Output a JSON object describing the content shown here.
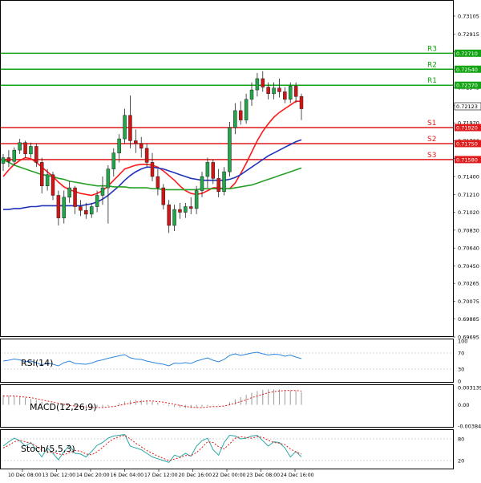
{
  "chart_data": {
    "type": "candlestick",
    "symbol_price": "0.72123",
    "price_axis": {
      "ylim": [
        0.69695,
        0.732
      ],
      "ticks": [
        "0.73105",
        "0.72915",
        "0.72725",
        "0.72535",
        "0.72345",
        "0.72155",
        "0.71970",
        "0.71780",
        "0.71590",
        "0.71400",
        "0.71210",
        "0.71020",
        "0.70830",
        "0.70640",
        "0.70450",
        "0.70265",
        "0.70075",
        "0.69885",
        "0.69695"
      ]
    },
    "time_axis": {
      "labels": [
        "10 Dec 08:00",
        "13 Dec 12:00",
        "14 Dec 20:00",
        "16 Dec 04:00",
        "17 Dec 12:00",
        "20 Dec 16:00",
        "22 Dec 00:00",
        "23 Dec 08:00",
        "24 Dec 16:00"
      ]
    },
    "levels": [
      {
        "label": "R3",
        "value": 0.7271,
        "value_text": "0.72710",
        "color": "#12a412"
      },
      {
        "label": "R2",
        "value": 0.7254,
        "value_text": "0.72540",
        "color": "#12a412"
      },
      {
        "label": "R1",
        "value": 0.7237,
        "value_text": "0.72370",
        "color": "#12a412"
      },
      {
        "label": "S1",
        "value": 0.7192,
        "value_text": "0.71920",
        "color": "#e01b1b"
      },
      {
        "label": "S2",
        "value": 0.7175,
        "value_text": "0.71750",
        "color": "#e01b1b"
      },
      {
        "label": "S3",
        "value": 0.7158,
        "value_text": "0.71580",
        "color": "#e01b1b"
      }
    ],
    "candles": [
      {
        "o": 0.7154,
        "h": 0.7164,
        "l": 0.7146,
        "c": 0.716
      },
      {
        "o": 0.716,
        "h": 0.7168,
        "l": 0.715,
        "c": 0.7156
      },
      {
        "o": 0.7156,
        "h": 0.7171,
        "l": 0.7152,
        "c": 0.7168
      },
      {
        "o": 0.7168,
        "h": 0.718,
        "l": 0.7164,
        "c": 0.7176
      },
      {
        "o": 0.7176,
        "h": 0.7178,
        "l": 0.716,
        "c": 0.7164
      },
      {
        "o": 0.7164,
        "h": 0.7176,
        "l": 0.716,
        "c": 0.7172
      },
      {
        "o": 0.7172,
        "h": 0.7175,
        "l": 0.715,
        "c": 0.7155
      },
      {
        "o": 0.7155,
        "h": 0.716,
        "l": 0.7122,
        "c": 0.713
      },
      {
        "o": 0.713,
        "h": 0.7148,
        "l": 0.7125,
        "c": 0.7142
      },
      {
        "o": 0.7142,
        "h": 0.7145,
        "l": 0.7115,
        "c": 0.712
      },
      {
        "o": 0.712,
        "h": 0.7125,
        "l": 0.7088,
        "c": 0.7096
      },
      {
        "o": 0.7096,
        "h": 0.7125,
        "l": 0.709,
        "c": 0.7118
      },
      {
        "o": 0.7118,
        "h": 0.7135,
        "l": 0.7112,
        "c": 0.7128
      },
      {
        "o": 0.7128,
        "h": 0.713,
        "l": 0.71,
        "c": 0.7108
      },
      {
        "o": 0.7108,
        "h": 0.7115,
        "l": 0.7098,
        "c": 0.7104
      },
      {
        "o": 0.7104,
        "h": 0.7112,
        "l": 0.7095,
        "c": 0.71
      },
      {
        "o": 0.71,
        "h": 0.7112,
        "l": 0.7096,
        "c": 0.7108
      },
      {
        "o": 0.7108,
        "h": 0.7125,
        "l": 0.7102,
        "c": 0.712
      },
      {
        "o": 0.712,
        "h": 0.714,
        "l": 0.711,
        "c": 0.7128
      },
      {
        "o": 0.7128,
        "h": 0.7152,
        "l": 0.709,
        "c": 0.7148
      },
      {
        "o": 0.7148,
        "h": 0.717,
        "l": 0.714,
        "c": 0.7165
      },
      {
        "o": 0.7165,
        "h": 0.7185,
        "l": 0.7155,
        "c": 0.718
      },
      {
        "o": 0.718,
        "h": 0.7212,
        "l": 0.7175,
        "c": 0.7205
      },
      {
        "o": 0.7205,
        "h": 0.7226,
        "l": 0.717,
        "c": 0.7178
      },
      {
        "o": 0.7178,
        "h": 0.719,
        "l": 0.7165,
        "c": 0.7175
      },
      {
        "o": 0.7175,
        "h": 0.7182,
        "l": 0.716,
        "c": 0.717
      },
      {
        "o": 0.717,
        "h": 0.7175,
        "l": 0.715,
        "c": 0.7155
      },
      {
        "o": 0.7155,
        "h": 0.7165,
        "l": 0.7135,
        "c": 0.714
      },
      {
        "o": 0.714,
        "h": 0.7148,
        "l": 0.712,
        "c": 0.7128
      },
      {
        "o": 0.7128,
        "h": 0.7132,
        "l": 0.7105,
        "c": 0.711
      },
      {
        "o": 0.711,
        "h": 0.7115,
        "l": 0.708,
        "c": 0.7088
      },
      {
        "o": 0.7088,
        "h": 0.711,
        "l": 0.7082,
        "c": 0.7105
      },
      {
        "o": 0.7105,
        "h": 0.7112,
        "l": 0.7095,
        "c": 0.7102
      },
      {
        "o": 0.7102,
        "h": 0.7112,
        "l": 0.7096,
        "c": 0.7108
      },
      {
        "o": 0.7108,
        "h": 0.7118,
        "l": 0.71,
        "c": 0.7106
      },
      {
        "o": 0.7106,
        "h": 0.713,
        "l": 0.71,
        "c": 0.7125
      },
      {
        "o": 0.7125,
        "h": 0.7145,
        "l": 0.7118,
        "c": 0.714
      },
      {
        "o": 0.714,
        "h": 0.716,
        "l": 0.7128,
        "c": 0.7155
      },
      {
        "o": 0.7155,
        "h": 0.7158,
        "l": 0.7132,
        "c": 0.7138
      },
      {
        "o": 0.7138,
        "h": 0.7148,
        "l": 0.7118,
        "c": 0.7124
      },
      {
        "o": 0.7124,
        "h": 0.715,
        "l": 0.712,
        "c": 0.7145
      },
      {
        "o": 0.7145,
        "h": 0.7198,
        "l": 0.714,
        "c": 0.7192
      },
      {
        "o": 0.7192,
        "h": 0.7218,
        "l": 0.7185,
        "c": 0.721
      },
      {
        "o": 0.721,
        "h": 0.722,
        "l": 0.7195,
        "c": 0.72
      },
      {
        "o": 0.72,
        "h": 0.7228,
        "l": 0.7196,
        "c": 0.7222
      },
      {
        "o": 0.7222,
        "h": 0.724,
        "l": 0.7215,
        "c": 0.7232
      },
      {
        "o": 0.7232,
        "h": 0.725,
        "l": 0.7225,
        "c": 0.7244
      },
      {
        "o": 0.7244,
        "h": 0.7252,
        "l": 0.723,
        "c": 0.7235
      },
      {
        "o": 0.7235,
        "h": 0.724,
        "l": 0.7222,
        "c": 0.7228
      },
      {
        "o": 0.7228,
        "h": 0.724,
        "l": 0.7222,
        "c": 0.7234
      },
      {
        "o": 0.7234,
        "h": 0.7244,
        "l": 0.7224,
        "c": 0.723
      },
      {
        "o": 0.723,
        "h": 0.7235,
        "l": 0.7218,
        "c": 0.7222
      },
      {
        "o": 0.7222,
        "h": 0.724,
        "l": 0.7218,
        "c": 0.7236
      },
      {
        "o": 0.7236,
        "h": 0.724,
        "l": 0.7218,
        "c": 0.7225
      },
      {
        "o": 0.7225,
        "h": 0.7228,
        "l": 0.72,
        "c": 0.7212
      }
    ],
    "moving_averages": [
      {
        "color": "#ff1a1a",
        "values": [
          0.714,
          0.7147,
          0.7153,
          0.7157,
          0.716,
          0.7159,
          0.7155,
          0.715,
          0.7145,
          0.714,
          0.7134,
          0.7129,
          0.7126,
          0.7124,
          0.7122,
          0.7121,
          0.712,
          0.7122,
          0.7125,
          0.713,
          0.7136,
          0.7142,
          0.7148,
          0.715,
          0.7152,
          0.7153,
          0.7153,
          0.7152,
          0.715,
          0.7146,
          0.7141,
          0.7136,
          0.713,
          0.7125,
          0.7122,
          0.7121,
          0.7122,
          0.7125,
          0.7128,
          0.7128,
          0.7127,
          0.7127,
          0.7133,
          0.7143,
          0.7154,
          0.7166,
          0.7178,
          0.7188,
          0.7196,
          0.7203,
          0.7208,
          0.7212,
          0.7216,
          0.722,
          0.722
        ]
      },
      {
        "color": "#2233bb",
        "values": [
          0.7105,
          0.7105,
          0.7106,
          0.7106,
          0.7107,
          0.7108,
          0.7108,
          0.7109,
          0.7109,
          0.7109,
          0.7109,
          0.7109,
          0.7109,
          0.7109,
          0.7109,
          0.711,
          0.7111,
          0.7113,
          0.7116,
          0.712,
          0.7125,
          0.713,
          0.7136,
          0.7141,
          0.7145,
          0.7148,
          0.715,
          0.715,
          0.7149,
          0.7148,
          0.7146,
          0.7144,
          0.7142,
          0.714,
          0.7138,
          0.7137,
          0.7136,
          0.7136,
          0.7136,
          0.7136,
          0.7136,
          0.7137,
          0.7139,
          0.7142,
          0.7146,
          0.715,
          0.7154,
          0.7158,
          0.7162,
          0.7165,
          0.7168,
          0.7171,
          0.7174,
          0.7177,
          0.7179
        ]
      },
      {
        "color": "#28a028",
        "values": [
          0.7158,
          0.7155,
          0.7152,
          0.715,
          0.7148,
          0.7146,
          0.7144,
          0.7142,
          0.7141,
          0.714,
          0.7138,
          0.7137,
          0.7135,
          0.7134,
          0.7133,
          0.7132,
          0.7131,
          0.713,
          0.713,
          0.713,
          0.7129,
          0.7129,
          0.7129,
          0.7128,
          0.7128,
          0.7128,
          0.7128,
          0.7127,
          0.7127,
          0.7126,
          0.7126,
          0.7126,
          0.7126,
          0.7126,
          0.7126,
          0.7126,
          0.7127,
          0.7127,
          0.7127,
          0.7127,
          0.7127,
          0.7127,
          0.7128,
          0.7129,
          0.713,
          0.7131,
          0.7133,
          0.7135,
          0.7137,
          0.7139,
          0.7141,
          0.7143,
          0.7145,
          0.7147,
          0.7149
        ]
      }
    ],
    "rsi": {
      "label": "RSI(14)",
      "ticks": [
        "100",
        "70",
        "30",
        "0"
      ],
      "levels": [
        70,
        30
      ],
      "values": [
        50,
        52,
        55,
        53,
        48,
        50,
        46,
        40,
        45,
        42,
        38,
        46,
        50,
        44,
        43,
        42,
        45,
        50,
        53,
        57,
        60,
        63,
        66,
        58,
        55,
        54,
        50,
        47,
        44,
        42,
        38,
        45,
        44,
        46,
        44,
        50,
        54,
        58,
        52,
        48,
        54,
        64,
        68,
        64,
        67,
        70,
        72,
        68,
        65,
        67,
        66,
        62,
        65,
        60,
        56
      ]
    },
    "macd": {
      "label": "MACD(12,26,9)",
      "ticks": [
        "0.003139",
        "0.00",
        "-0.00384"
      ],
      "hist": [
        0.0018,
        0.0017,
        0.0016,
        0.0015,
        0.0013,
        0.0011,
        0.0009,
        0.0006,
        0.0004,
        0.0002,
        0.0,
        -0.0002,
        -0.0003,
        -0.0004,
        -0.0005,
        -0.0006,
        -0.0006,
        -0.0005,
        -0.0004,
        -0.0002,
        0.0,
        0.0003,
        0.0006,
        0.0008,
        0.0009,
        0.0009,
        0.0008,
        0.0006,
        0.0004,
        0.0001,
        -0.0002,
        -0.0004,
        -0.0005,
        -0.0006,
        -0.0006,
        -0.0005,
        -0.0004,
        -0.0002,
        -0.0001,
        -0.0001,
        0.0,
        0.0005,
        0.001,
        0.0014,
        0.0018,
        0.0022,
        0.0025,
        0.0027,
        0.0028,
        0.0028,
        0.0028,
        0.0027,
        0.0026,
        0.0025,
        0.0023
      ],
      "signal": [
        0.0016,
        0.0016,
        0.0016,
        0.0015,
        0.0014,
        0.0013,
        0.0011,
        0.0009,
        0.0007,
        0.0005,
        0.0003,
        0.0001,
        -0.0001,
        -0.0002,
        -0.0003,
        -0.0004,
        -0.0005,
        -0.0005,
        -0.0005,
        -0.0004,
        -0.0003,
        -0.0001,
        0.0001,
        0.0003,
        0.0005,
        0.0006,
        0.0007,
        0.0007,
        0.0006,
        0.0005,
        0.0003,
        0.0001,
        -0.0001,
        -0.0003,
        -0.0004,
        -0.0005,
        -0.0005,
        -0.0004,
        -0.0003,
        -0.0003,
        -0.0002,
        0.0,
        0.0003,
        0.0006,
        0.0009,
        0.0013,
        0.0016,
        0.0019,
        0.0022,
        0.0024,
        0.0025,
        0.0026,
        0.0026,
        0.0026,
        0.0025
      ]
    },
    "stoch": {
      "label": "Stoch(5,5,3)",
      "ticks": [
        "80",
        "20"
      ],
      "levels": [
        80,
        20
      ],
      "main": [
        60,
        72,
        82,
        75,
        60,
        70,
        50,
        30,
        55,
        40,
        22,
        45,
        62,
        40,
        38,
        30,
        45,
        62,
        70,
        82,
        88,
        90,
        92,
        60,
        55,
        50,
        40,
        30,
        25,
        20,
        15,
        35,
        30,
        40,
        32,
        60,
        75,
        82,
        50,
        35,
        70,
        90,
        88,
        80,
        82,
        88,
        90,
        75,
        60,
        72,
        70,
        55,
        30,
        45,
        30
      ],
      "signal": [
        55,
        62,
        72,
        76,
        72,
        68,
        60,
        48,
        44,
        42,
        38,
        36,
        42,
        48,
        46,
        38,
        36,
        44,
        56,
        70,
        80,
        86,
        90,
        80,
        68,
        58,
        48,
        40,
        32,
        26,
        20,
        24,
        28,
        34,
        34,
        42,
        56,
        72,
        70,
        58,
        52,
        66,
        82,
        86,
        84,
        82,
        86,
        84,
        76,
        70,
        68,
        64,
        52,
        44,
        38
      ]
    }
  }
}
